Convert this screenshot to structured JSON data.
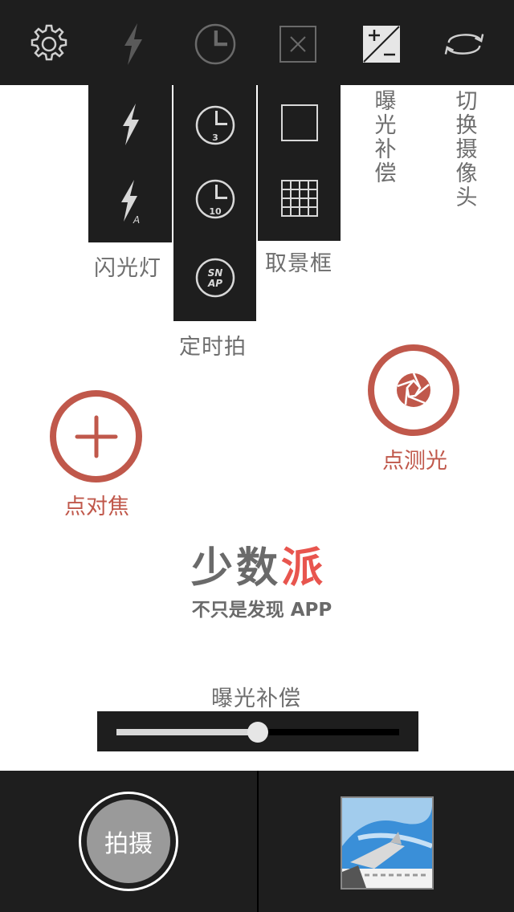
{
  "top_bar": {
    "icons": [
      "gear-icon",
      "flash-icon",
      "timer-icon",
      "frame-off-icon",
      "exposure-compensation-icon",
      "switch-camera-icon"
    ]
  },
  "dropdowns": {
    "flash": {
      "label": "闪光灯",
      "options": [
        "flash-on-icon",
        "flash-auto-icon"
      ],
      "auto_badge": "A"
    },
    "timer": {
      "label": "定时拍",
      "options": [
        "timer-3s-icon",
        "timer-10s-icon",
        "snap-icon"
      ],
      "t3": "3",
      "t10": "10",
      "snap_line1": "SN",
      "snap_line2": "AP"
    },
    "frame": {
      "label": "取景框",
      "options": [
        "frame-square-icon",
        "frame-grid-icon"
      ]
    }
  },
  "vertical_labels": {
    "exposure": "曝光补偿",
    "switch_camera": "切换摄像头"
  },
  "focus": {
    "label": "点对焦"
  },
  "metering": {
    "label": "点测光"
  },
  "watermark": {
    "title_part1": "少数",
    "title_part2": "派",
    "subtitle": "不只是发现 APP"
  },
  "exposure_slider": {
    "label": "曝光补偿",
    "value": 0.5
  },
  "bottom_bar": {
    "shutter_label": "拍摄"
  },
  "colors": {
    "accent": "#c0584b",
    "bar": "#1e1e1e",
    "brand_red": "#e8554e"
  }
}
